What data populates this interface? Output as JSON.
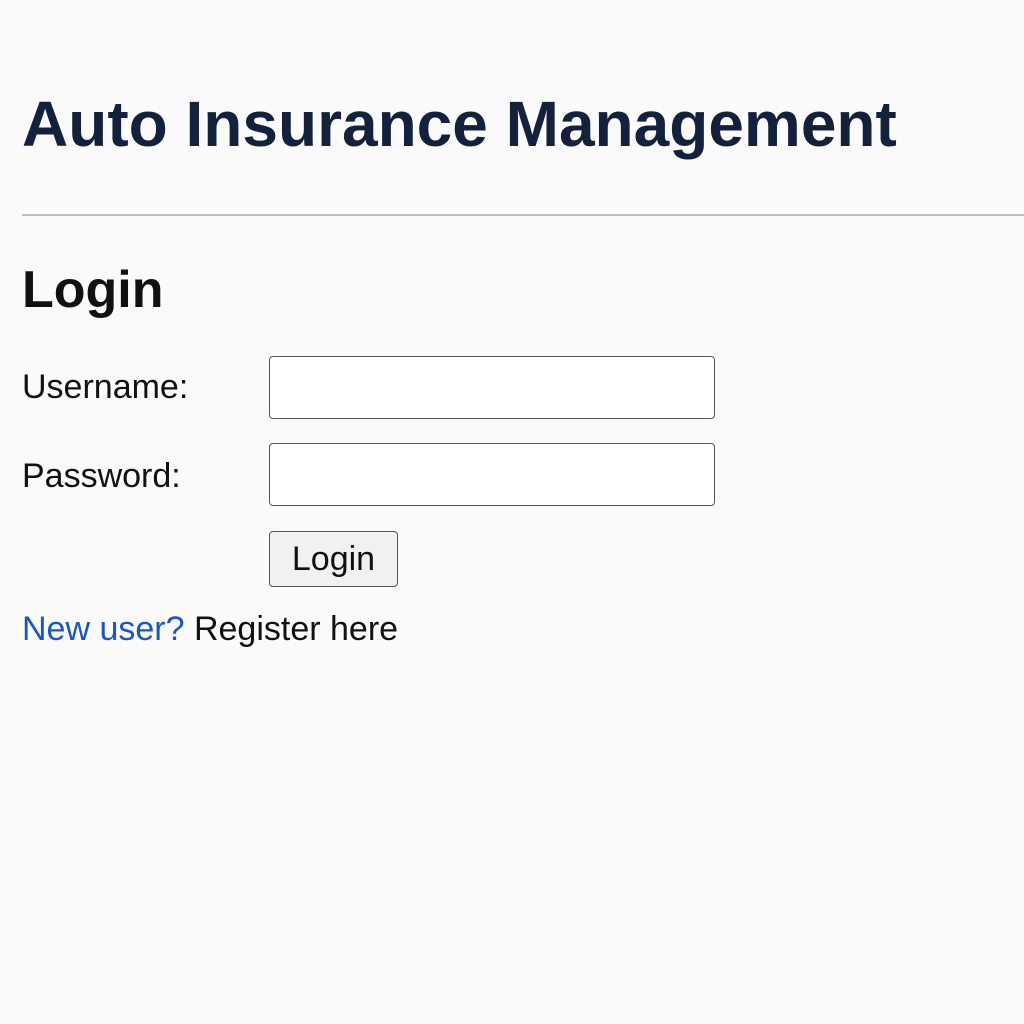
{
  "header": {
    "app_title": "Auto Insurance Management"
  },
  "login": {
    "title": "Login",
    "username_label": "Username:",
    "username_value": "",
    "password_label": "Password:",
    "password_value": "",
    "button_label": "Login"
  },
  "register": {
    "link_text": "New user?",
    "text": "Register here"
  },
  "colors": {
    "title": "#14213d",
    "link": "#1a56c4",
    "background": "#fafafa"
  }
}
